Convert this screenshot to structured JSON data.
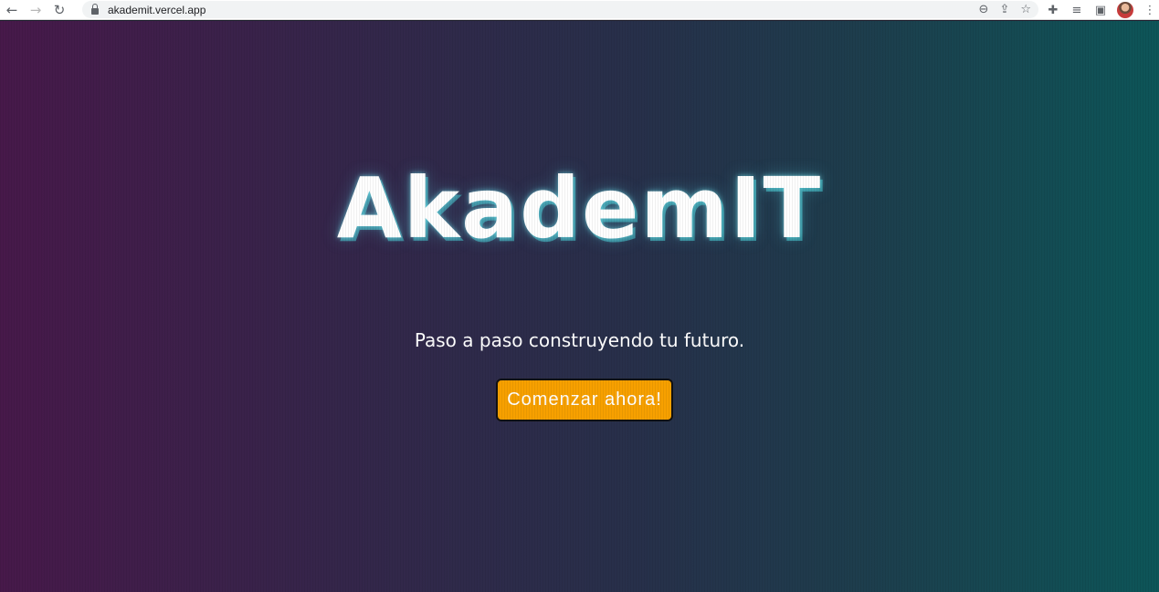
{
  "browser": {
    "url": "akademit.vercel.app",
    "nav_icons": [
      "back-arrow-icon",
      "forward-arrow-icon",
      "reload-icon"
    ],
    "omnibox_icons": [
      "zoom-icon",
      "share-icon",
      "bookmark-star-icon"
    ],
    "toolbar_icons": [
      "extensions-puzzle-icon",
      "media-queue-icon",
      "side-panel-icon",
      "profile-avatar",
      "menu-kebab-icon"
    ]
  },
  "hero": {
    "logo": "AkademIT",
    "tagline": "Paso a paso construyendo tu futuro.",
    "cta_label": "Comenzar ahora!"
  },
  "colors": {
    "cta_background": "#f7a000",
    "gradient_left": "#47194a",
    "gradient_right": "#0d5558",
    "logo_glow": "#46c8d2"
  }
}
